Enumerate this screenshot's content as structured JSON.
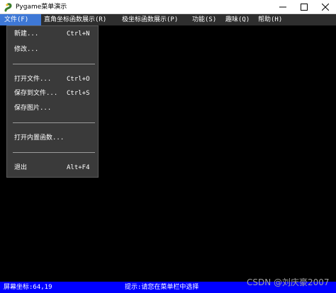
{
  "window": {
    "title": "Pygame菜单演示",
    "icon": "snake-icon"
  },
  "menubar": {
    "items": [
      {
        "label": "文件(F)"
      },
      {
        "label": "直角坐标函数展示(R)"
      },
      {
        "label": "极坐标函数展示(P)"
      },
      {
        "label": "功能(S)"
      },
      {
        "label": "趣味(Q)"
      },
      {
        "label": "帮助(H)"
      }
    ],
    "active_index": 0
  },
  "file_menu": {
    "items": [
      {
        "label": "新建...",
        "shortcut": "Ctrl+N"
      },
      {
        "label": "修改...",
        "shortcut": ""
      },
      {
        "label": "打开文件...",
        "shortcut": "Ctrl+O"
      },
      {
        "label": "保存到文件...",
        "shortcut": "Ctrl+S"
      },
      {
        "label": "保存图片...",
        "shortcut": ""
      },
      {
        "label": "打开内置函数...",
        "shortcut": ""
      },
      {
        "label": "退出",
        "shortcut": "Alt+F4"
      }
    ]
  },
  "statusbar": {
    "coords": "屏幕坐标:64,19",
    "hint": "提示:请您在菜单栏中选择"
  },
  "watermark": "CSDN @刘庆豪2007",
  "colors": {
    "canvas": "#000000",
    "menubar": "#2e2e2e",
    "active_menu": "#3e78d6",
    "dropdown": "#3a3a3a",
    "statusbar": "#0000ff"
  }
}
